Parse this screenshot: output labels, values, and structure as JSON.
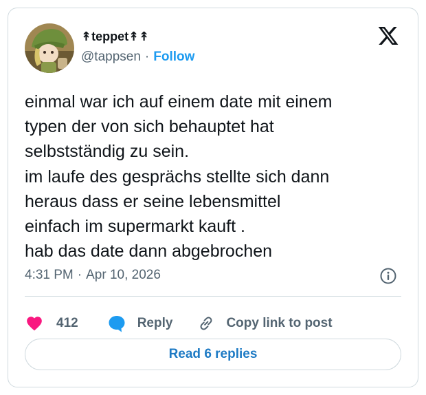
{
  "author": {
    "display_name": "↟teppet↟↟",
    "handle": "@tappsen",
    "separator": "·",
    "follow_label": "Follow"
  },
  "tweet": {
    "lines": [
      "einmal war ich auf einem date mit einem",
      "typen der von sich behauptet hat",
      "selbstständig zu sein.",
      "im laufe des gesprächs stellte sich dann",
      "heraus dass er seine lebensmittel",
      "einfach im supermarkt kauft .",
      "hab das date dann abgebrochen"
    ],
    "time": "4:31 PM",
    "separator": "·",
    "date": "Apr 10, 2026"
  },
  "actions": {
    "like_count": "412",
    "reply_label": "Reply",
    "copy_label": "Copy link to post"
  },
  "footer": {
    "read_replies_label": "Read 6 replies"
  },
  "colors": {
    "accent": "#1d9bf0",
    "heart": "#f91880",
    "reply_bubble": "#1d9bf0",
    "muted": "#536471",
    "border": "#cfd9de"
  },
  "icons": {
    "brand": "x-logo-icon",
    "like": "heart-icon",
    "reply": "chat-bubble-icon",
    "copy": "link-icon",
    "info": "info-icon"
  }
}
